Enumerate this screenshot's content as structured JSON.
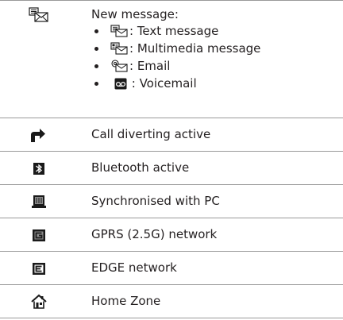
{
  "rows": [
    {
      "icon": "new-message-icon",
      "description": "New message:",
      "items": [
        {
          "icon": "text-message-icon",
          "label": ": Text message"
        },
        {
          "icon": "multimedia-message-icon",
          "label": ": Multimedia message"
        },
        {
          "icon": "email-icon",
          "label": ": Email"
        },
        {
          "icon": "voicemail-icon",
          "label": " : Voicemail"
        }
      ]
    },
    {
      "icon": "call-divert-icon",
      "description": "Call diverting active"
    },
    {
      "icon": "bluetooth-icon",
      "description": "Bluetooth active"
    },
    {
      "icon": "pc-sync-icon",
      "description": "Synchronised with PC"
    },
    {
      "icon": "gprs-icon",
      "description": "GPRS (2.5G) network"
    },
    {
      "icon": "edge-icon",
      "description": "EDGE network"
    },
    {
      "icon": "home-zone-icon",
      "description": "Home Zone"
    }
  ],
  "colors": {
    "text": "#231f20",
    "rule": "#9a9a9a",
    "icon_dark": "#1a1a1a",
    "icon_grey": "#8c8c8c"
  }
}
